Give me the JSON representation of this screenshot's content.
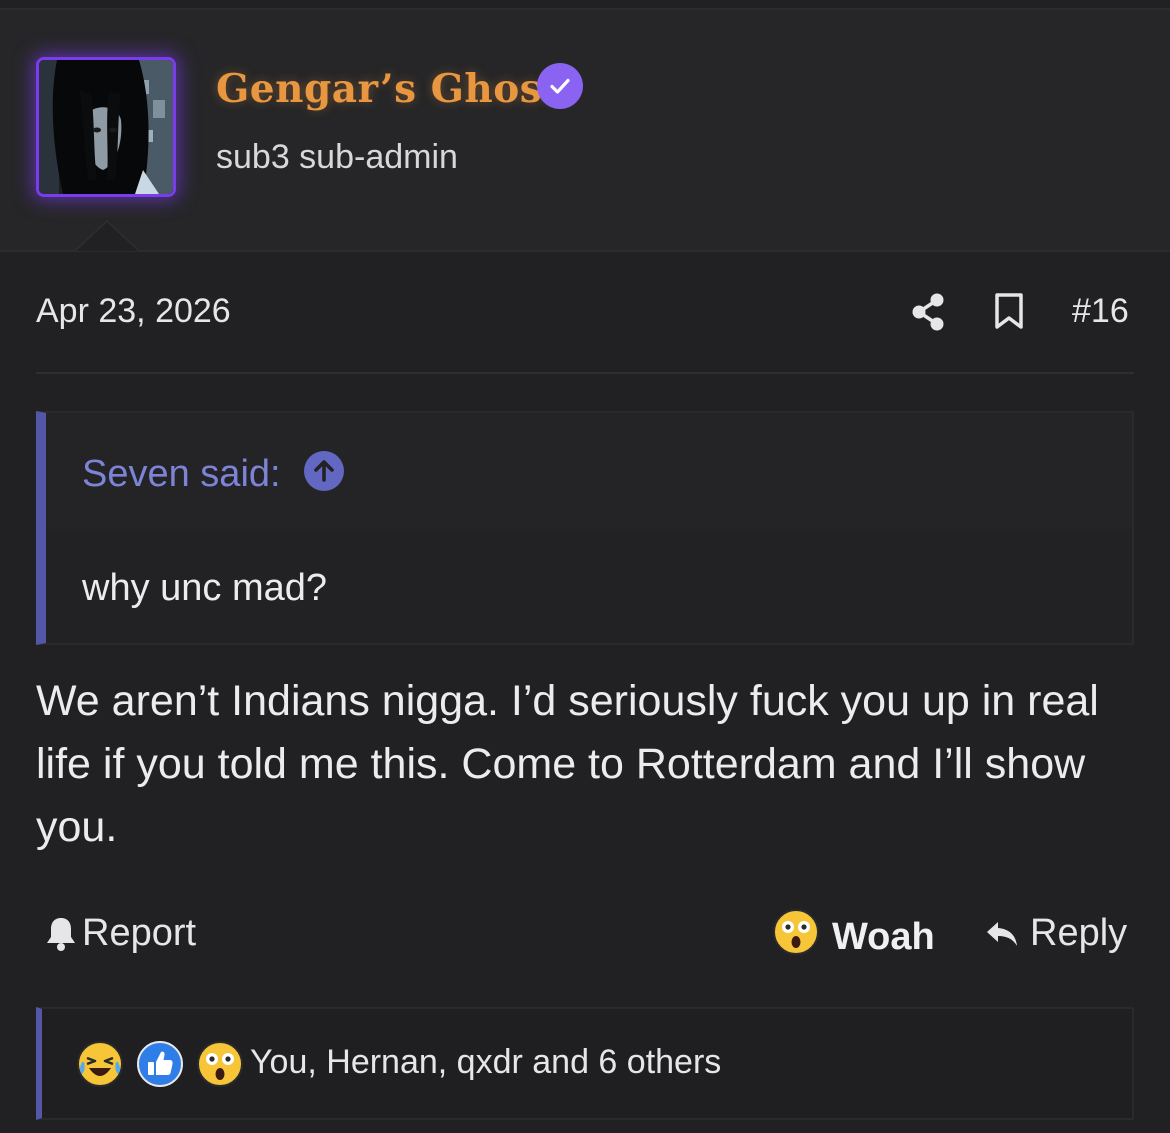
{
  "user": {
    "name": "Gengar’s Ghost",
    "title": "sub3 sub-admin",
    "avatar_icon": "avatar-image",
    "verified_icon": "verified-check-icon",
    "name_color": "#e8963f",
    "avatar_glow": "#7b3cf0"
  },
  "post": {
    "date": "Apr 23, 2026",
    "number": "#16",
    "share_icon": "share-icon",
    "bookmark_icon": "bookmark-icon",
    "quote": {
      "author": "Seven said:",
      "text": "why unc mad?",
      "accent": "#5457a8"
    },
    "body": "We aren’t Indians nigga. I’d seriously fuck you up in real life if you told me this. Come to Rotterdam and I’ll show you."
  },
  "actions": {
    "report_label": "Report",
    "reaction_label": "Woah",
    "reply_label": "Reply"
  },
  "reactions": {
    "icons": [
      "laughing-crying-icon",
      "thumbs-up-icon",
      "astonished-icon"
    ],
    "summary": "You, Hernan, qxdr and 6 others"
  }
}
